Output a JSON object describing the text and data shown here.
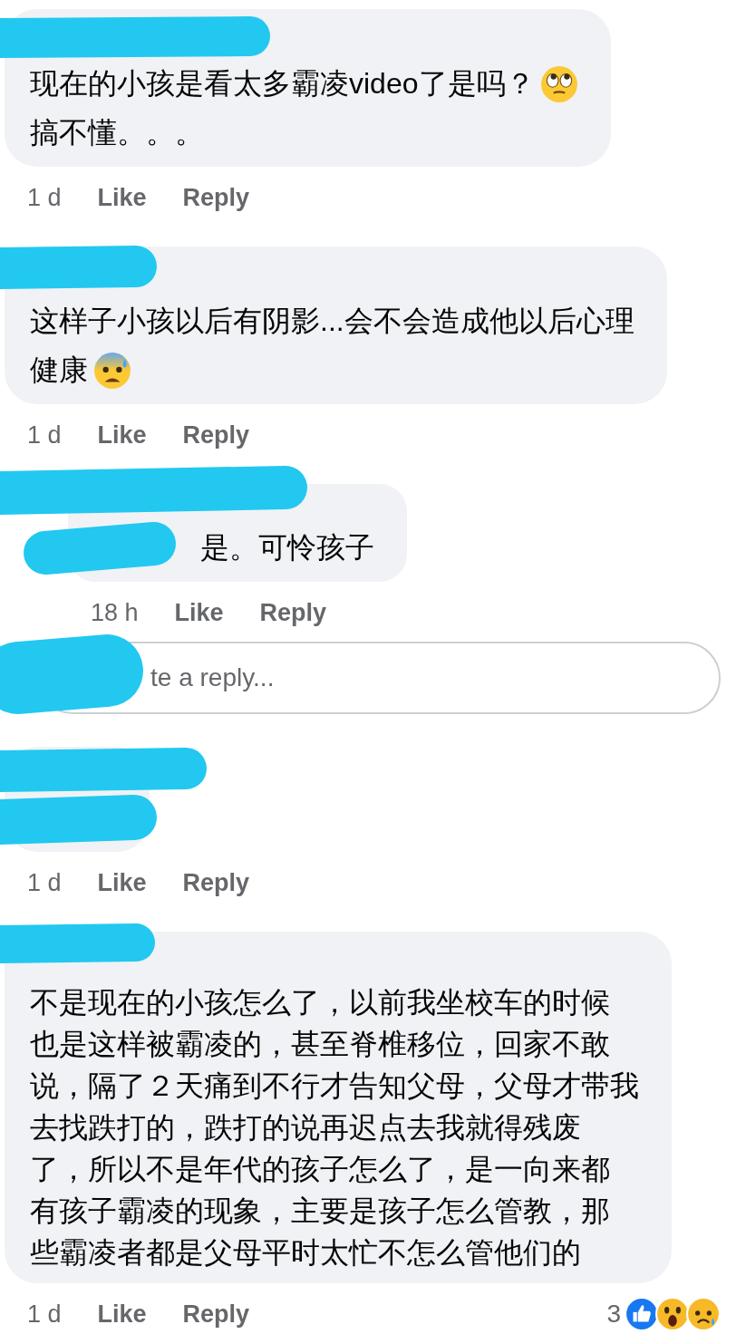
{
  "comments": [
    {
      "kind": "comment",
      "lines": [
        {
          "text": "现在的小孩是看太多霸凌video了是吗？"
        },
        {
          "text": "搞不懂。。。"
        }
      ],
      "time": "1 d",
      "like": "Like",
      "reply": "Reply"
    },
    {
      "kind": "comment",
      "lines": [
        {
          "text": "这样子小孩以后有阴影...会不会造成他以后心理"
        },
        {
          "text": "健康"
        }
      ],
      "time": "1 d",
      "like": "Like",
      "reply": "Reply"
    },
    {
      "kind": "reply",
      "lines": [
        {
          "text": "是。可怜孩子"
        }
      ],
      "time": "18 h",
      "like": "Like",
      "reply": "Reply"
    },
    {
      "kind": "reply_box",
      "placeholder": "te a reply..."
    },
    {
      "kind": "comment",
      "time": "1 d",
      "like": "Like",
      "reply": "Reply"
    },
    {
      "kind": "comment",
      "lines": [
        {
          "text": "不是现在的小孩怎么了，以前我坐校车的时候"
        },
        {
          "text": "也是这样被霸凌的，甚至脊椎移位，回家不敢"
        },
        {
          "text": "说，隔了２天痛到不行才告知父母，父母才带我"
        },
        {
          "text": "去找跌打的，跌打的说再迟点去我就得残废"
        },
        {
          "text": "了，所以不是年代的孩子怎么了，是一向来都"
        },
        {
          "text": "有孩子霸凌的现象，主要是孩子怎么管教，那"
        },
        {
          "text": "些霸凌者都是父母平时太忙不怎么管他们的"
        }
      ],
      "time": "1 d",
      "like": "Like",
      "reply": "Reply",
      "reactions": {
        "count": "3"
      }
    }
  ]
}
